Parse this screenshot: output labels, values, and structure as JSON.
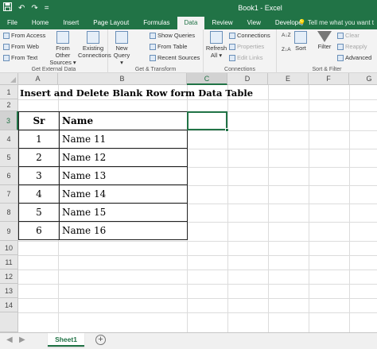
{
  "window": {
    "title": "Book1 - Excel"
  },
  "qat": {
    "save_icon": "save-icon",
    "undo_glyph": "↶",
    "redo_glyph": "↷",
    "customize_glyph": "="
  },
  "ribbon": {
    "tabs": [
      "File",
      "Home",
      "Insert",
      "Page Layout",
      "Formulas",
      "Data",
      "Review",
      "View",
      "Developer"
    ],
    "active_tab": "Data",
    "tell_me": "Tell me what you want t",
    "groups": {
      "get_external": {
        "label": "Get External Data",
        "from_access": "From Access",
        "from_web": "From Web",
        "from_text": "From Text",
        "from_other_1": "From Other",
        "from_other_2": "Sources ▾",
        "existing_1": "Existing",
        "existing_2": "Connections"
      },
      "get_transform": {
        "label": "Get & Transform",
        "new_query_1": "New",
        "new_query_2": "Query ▾",
        "show_queries": "Show Queries",
        "from_table": "From Table",
        "recent_sources": "Recent Sources"
      },
      "connections": {
        "label": "Connections",
        "refresh_1": "Refresh",
        "refresh_2": "All ▾",
        "connections": "Connections",
        "properties": "Properties",
        "edit_links": "Edit Links"
      },
      "sort_filter": {
        "label": "Sort & Filter",
        "sort": "Sort",
        "filter": "Filter",
        "clear": "Clear",
        "reapply": "Reapply",
        "advanced": "Advanced",
        "sort_az": "A↓Z",
        "sort_za": "Z↓A"
      }
    }
  },
  "grid": {
    "columns": [
      "A",
      "B",
      "C",
      "D",
      "E",
      "F",
      "G"
    ],
    "rows": [
      "1",
      "2",
      "3",
      "4",
      "5",
      "6",
      "7",
      "8",
      "9",
      "10",
      "11",
      "12",
      "13",
      "14"
    ],
    "selected_column": "C",
    "selected_row": "3",
    "title_cell": "Insert and Delete Blank Row form Data Table",
    "table": {
      "headers": [
        "Sr",
        "Name"
      ],
      "rows": [
        [
          "1",
          "Name 11"
        ],
        [
          "2",
          "Name 12"
        ],
        [
          "3",
          "Name 13"
        ],
        [
          "4",
          "Name 14"
        ],
        [
          "5",
          "Name 15"
        ],
        [
          "6",
          "Name 16"
        ]
      ]
    }
  },
  "sheets": {
    "tabs": [
      "Sheet1"
    ],
    "active": "Sheet1",
    "add_glyph": "+",
    "prev_glyph": "◀",
    "next_glyph": "▶"
  },
  "colors": {
    "accent": "#217346",
    "grid_header": "#e6e6e6",
    "ribbon_bg": "#f3f3f3"
  }
}
